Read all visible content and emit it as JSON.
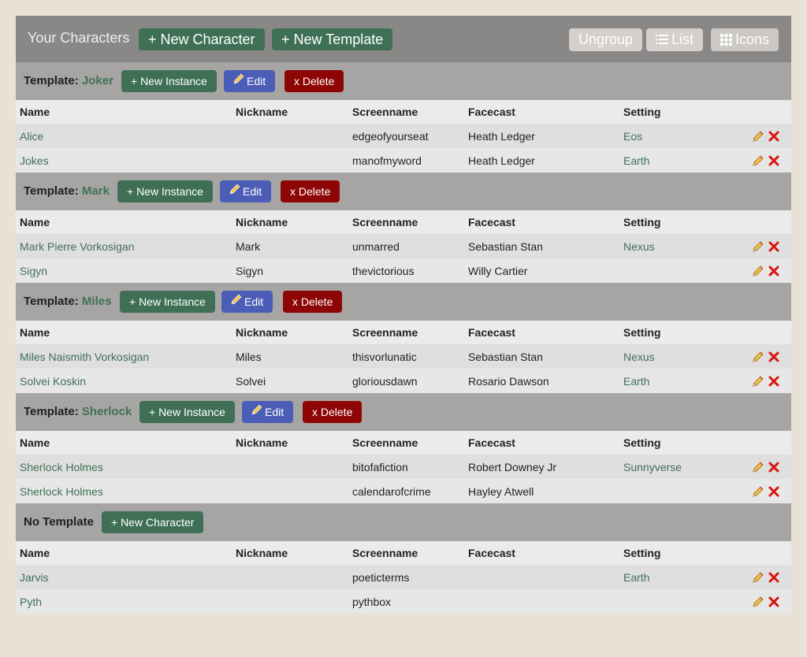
{
  "header": {
    "title": "Your Characters",
    "new_character": "+ New Character",
    "new_template": "+ New Template",
    "ungroup": "Ungroup",
    "list": "List",
    "icons": "Icons"
  },
  "columns": [
    "Name",
    "Nickname",
    "Screenname",
    "Facecast",
    "Setting"
  ],
  "groups": [
    {
      "label": "Template:",
      "name": "Joker",
      "new_label": "+ New Instance",
      "edit_label": "Edit",
      "delete_label": "x Delete",
      "rows": [
        {
          "name": "Alice",
          "nickname": "",
          "screenname": "edgeofyourseat",
          "facecast": "Heath Ledger",
          "setting": "Eos"
        },
        {
          "name": "Jokes",
          "nickname": "",
          "screenname": "manofmyword",
          "facecast": "Heath Ledger",
          "setting": "Earth"
        }
      ]
    },
    {
      "label": "Template:",
      "name": "Mark",
      "new_label": "+ New Instance",
      "edit_label": "Edit",
      "delete_label": "x Delete",
      "rows": [
        {
          "name": "Mark Pierre Vorkosigan",
          "nickname": "Mark",
          "screenname": "unmarred",
          "facecast": "Sebastian Stan",
          "setting": "Nexus"
        },
        {
          "name": "Sigyn",
          "nickname": "Sigyn",
          "screenname": "thevictorious",
          "facecast": "Willy Cartier",
          "setting": ""
        }
      ]
    },
    {
      "label": "Template:",
      "name": "Miles",
      "new_label": "+ New Instance",
      "edit_label": "Edit",
      "delete_label": "x Delete",
      "rows": [
        {
          "name": "Miles Naismith Vorkosigan",
          "nickname": "Miles",
          "screenname": "thisvorlunatic",
          "facecast": "Sebastian Stan",
          "setting": "Nexus"
        },
        {
          "name": "Solvei Koskin",
          "nickname": "Solvei",
          "screenname": "gloriousdawn",
          "facecast": "Rosario Dawson",
          "setting": "Earth"
        }
      ]
    },
    {
      "label": "Template:",
      "name": "Sherlock",
      "new_label": "+ New Instance",
      "edit_label": "Edit",
      "delete_label": "x Delete",
      "rows": [
        {
          "name": "Sherlock Holmes",
          "nickname": "",
          "screenname": "bitofafiction",
          "facecast": "Robert Downey Jr",
          "setting": "Sunnyverse"
        },
        {
          "name": "Sherlock Holmes",
          "nickname": "",
          "screenname": "calendarofcrime",
          "facecast": "Hayley Atwell",
          "setting": ""
        }
      ]
    },
    {
      "label": "No Template",
      "name": "",
      "new_label": "+ New Character",
      "rows": [
        {
          "name": "Jarvis",
          "nickname": "",
          "screenname": "poeticterms",
          "facecast": "",
          "setting": "Earth"
        },
        {
          "name": "Pyth",
          "nickname": "",
          "screenname": "pythbox",
          "facecast": "",
          "setting": ""
        }
      ]
    }
  ]
}
